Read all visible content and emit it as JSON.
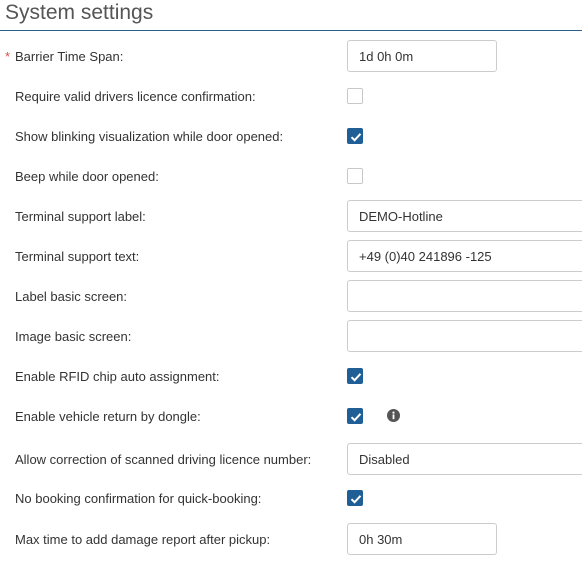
{
  "header": {
    "title": "System settings"
  },
  "rows": [
    {
      "label": "Barrier Time Span:",
      "required_mark": "*",
      "value": "1d 0h 0m"
    },
    {
      "label": "Require valid drivers licence confirmation:",
      "checked": false
    },
    {
      "label": "Show blinking visualization while door opened:",
      "checked": true
    },
    {
      "label": "Beep while door opened:",
      "checked": false
    },
    {
      "label": "Terminal support label:",
      "value": "DEMO-Hotline"
    },
    {
      "label": "Terminal support text:",
      "value": "+49 (0)40 241896 -125"
    },
    {
      "label": "Label basic screen:",
      "value": ""
    },
    {
      "label": "Image basic screen:",
      "value": ""
    },
    {
      "label": "Enable RFID chip auto assignment:",
      "checked": true
    },
    {
      "label": "Enable vehicle return by dongle:",
      "checked": true,
      "icon": "info-icon"
    },
    {
      "label": "Allow correction of scanned driving licence number:",
      "value": "Disabled"
    },
    {
      "label": "No booking confirmation for quick-booking:",
      "checked": true
    },
    {
      "label": "Max time to add damage report after pickup:",
      "value": "0h 30m"
    }
  ],
  "colors": {
    "accent": "#1f5f96",
    "required": "#d9534f",
    "header_rule": "#2b5f8a"
  }
}
